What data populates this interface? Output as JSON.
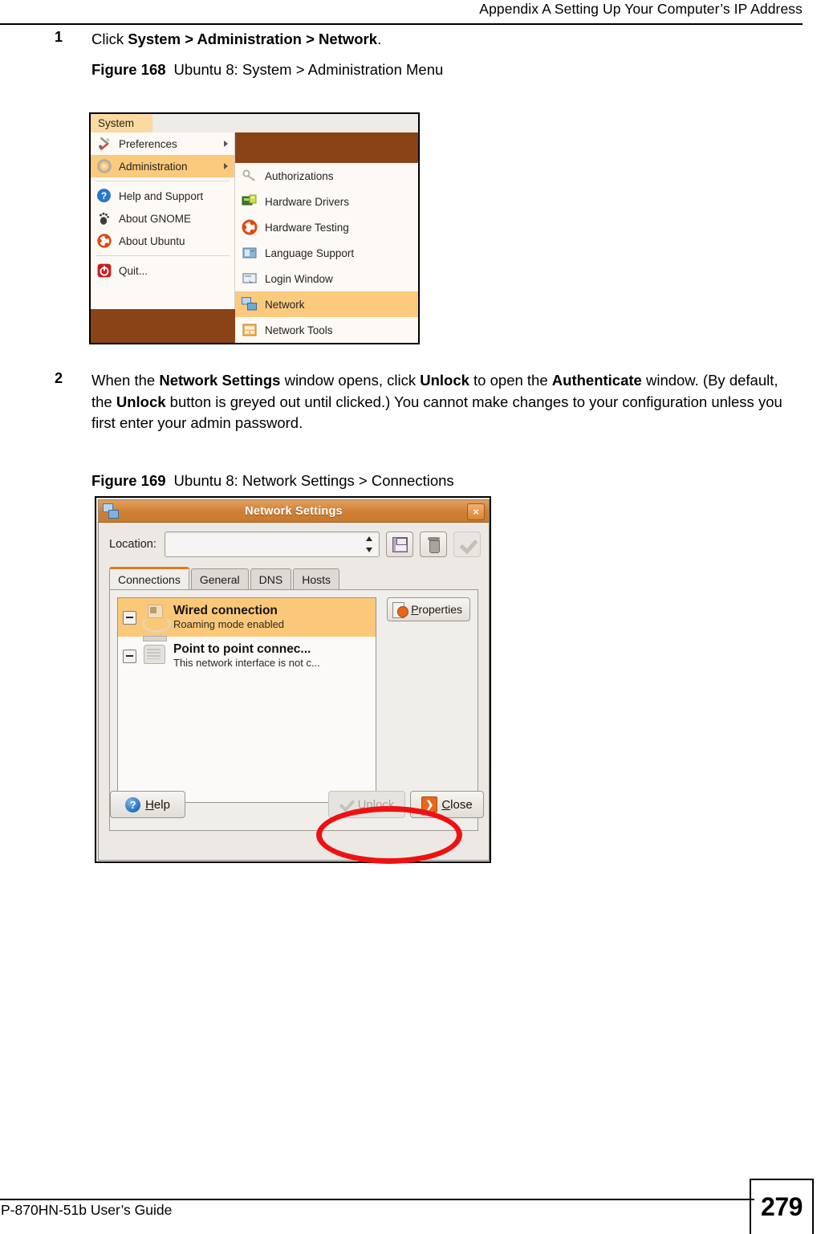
{
  "header": {
    "title": "Appendix A Setting Up Your Computer’s IP Address"
  },
  "steps": [
    {
      "number": "1",
      "text_parts": [
        {
          "t": "Click ",
          "b": false
        },
        {
          "t": "System > Administration > Network",
          "b": true
        },
        {
          "t": ".",
          "b": false
        }
      ],
      "plain": "Click System > Administration > Network."
    },
    {
      "number": "2",
      "plain": "When the Network Settings window opens, click Unlock to open the Authenticate window. (By default, the Unlock button is greyed out until clicked.) You cannot make changes to your configuration unless you first enter your admin password."
    }
  ],
  "figure_168": {
    "number": "Figure 168",
    "title": "Ubuntu 8: System > Administration Menu",
    "menubar": {
      "system_label": "System"
    },
    "menu_items": [
      {
        "label": "Preferences",
        "icon": "wrench-screwdriver-icon",
        "submenu_arrow": true,
        "highlighted": false
      },
      {
        "label": "Administration",
        "icon": "gear-icon",
        "submenu_arrow": true,
        "highlighted": true
      },
      {
        "label": "Help and Support",
        "icon": "help-question-icon",
        "submenu_arrow": false,
        "highlighted": false
      },
      {
        "label": "About GNOME",
        "icon": "gnome-foot-icon",
        "submenu_arrow": false,
        "highlighted": false
      },
      {
        "label": "About Ubuntu",
        "icon": "ubuntu-logo-icon",
        "submenu_arrow": false,
        "highlighted": false
      },
      {
        "label": "Quit...",
        "icon": "power-quit-icon",
        "submenu_arrow": false,
        "highlighted": false
      }
    ],
    "submenu_items": [
      {
        "label": "Authorizations",
        "icon": "keys-icon",
        "highlighted": false
      },
      {
        "label": "Hardware Drivers",
        "icon": "hardware-drivers-icon",
        "highlighted": false
      },
      {
        "label": "Hardware Testing",
        "icon": "ubuntu-logo-icon",
        "highlighted": false
      },
      {
        "label": "Language Support",
        "icon": "language-support-icon",
        "highlighted": false
      },
      {
        "label": "Login Window",
        "icon": "login-window-icon",
        "highlighted": false
      },
      {
        "label": "Network",
        "icon": "network-icon",
        "highlighted": true
      },
      {
        "label": "Network Tools",
        "icon": "network-tools-icon",
        "highlighted": false
      }
    ],
    "colors": {
      "highlight": "#fbca7d",
      "menu_background": "#fdfaf6",
      "desktop_brown": "#8a4317",
      "menubar_system": "#fbd9a0"
    }
  },
  "figure_169": {
    "number": "Figure 169",
    "title": "Ubuntu 8: Network Settings > Connections",
    "window": {
      "title": "Network Settings",
      "title_icon": "network-icon",
      "close_button": "×"
    },
    "location": {
      "label": "Location:",
      "value": "",
      "placeholder": ""
    },
    "toolbar_buttons": [
      {
        "name": "save-location-button",
        "icon": "floppy-save-icon",
        "enabled": true
      },
      {
        "name": "delete-location-button",
        "icon": "trash-icon",
        "enabled": true
      },
      {
        "name": "apply-location-button",
        "icon": "check-icon",
        "enabled": false
      }
    ],
    "tabs": [
      {
        "label": "Connections",
        "active": true
      },
      {
        "label": "General",
        "active": false
      },
      {
        "label": "DNS",
        "active": false
      },
      {
        "label": "Hosts",
        "active": false
      }
    ],
    "connections": [
      {
        "title": "Wired connection",
        "subtitle": "Roaming mode enabled",
        "icon": "wired-connection-icon",
        "selected": true
      },
      {
        "title": "Point to point connec...",
        "subtitle": "This network interface is not c...",
        "icon": "modem-icon",
        "selected": false
      }
    ],
    "properties_button": {
      "label": "Properties",
      "accel": "P",
      "icon": "properties-icon"
    },
    "footer_buttons": [
      {
        "name": "help-button",
        "label": "Help",
        "accel": "H",
        "icon": "help-question-icon",
        "enabled": true
      },
      {
        "name": "unlock-button",
        "label": "Unlock",
        "accel": "U",
        "icon": "check-icon",
        "enabled": false
      },
      {
        "name": "close-button",
        "label": "Close",
        "accel": "C",
        "icon": "close-icon",
        "enabled": true
      }
    ],
    "annotation": {
      "type": "red-ellipse",
      "color": "#ee1111",
      "target": "unlock-button"
    },
    "colors": {
      "titlebar": "#cf7f33",
      "selection": "#fbc87a",
      "active_tab_accent": "#e07b1e",
      "dialog_background": "#ece9e5"
    }
  },
  "footer": {
    "guide": "P-870HN-51b User’s Guide",
    "page_number": "279"
  }
}
